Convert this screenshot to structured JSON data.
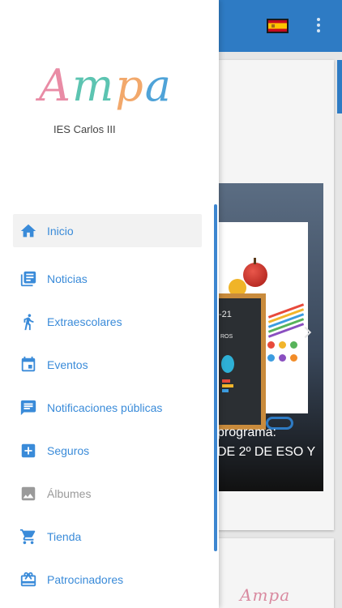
{
  "drawer": {
    "logo": {
      "word": "Ampa",
      "subtitle": "IES Carlos III"
    },
    "menu": [
      {
        "label": "Inicio",
        "icon": "home-icon",
        "active": true
      },
      {
        "label": "Noticias",
        "icon": "newspaper-icon"
      },
      {
        "label": "Extraescolares",
        "icon": "running-person-icon"
      },
      {
        "label": "Eventos",
        "icon": "calendar-icon"
      },
      {
        "label": "Notificaciones públicas",
        "icon": "message-icon"
      },
      {
        "label": "Seguros",
        "icon": "plus-box-icon"
      },
      {
        "label": "Álbumes",
        "icon": "image-icon",
        "disabled": true
      },
      {
        "label": "Tienda",
        "icon": "cart-icon"
      },
      {
        "label": "Patrocinadores",
        "icon": "gift-box-icon"
      }
    ]
  },
  "background": {
    "slide_board_text": "-21",
    "slide_board_subtext": "ROS",
    "slide_caption_line1": "programa:",
    "slide_caption_line2": "DE 2º DE ESO Y",
    "mini_logo": "Ampa"
  },
  "colors": {
    "appbar": "#2e7bc4",
    "menu_text": "#3a8bd9",
    "menu_text_disabled": "#9a9a9a",
    "active_bg": "#f2f2f2"
  }
}
